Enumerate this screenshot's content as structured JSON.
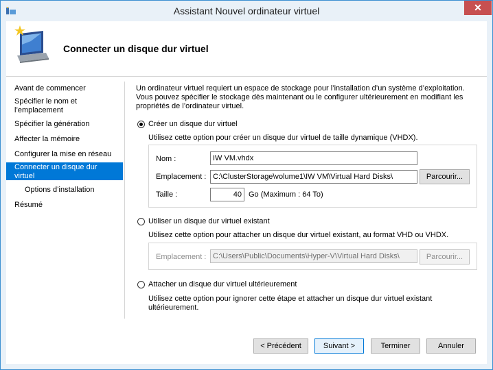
{
  "window": {
    "title": "Assistant Nouvel ordinateur virtuel",
    "close_glyph": "✕"
  },
  "header": {
    "title": "Connecter un disque dur virtuel"
  },
  "nav": {
    "items": [
      {
        "label": "Avant de commencer"
      },
      {
        "label": "Spécifier le nom et l’emplacement"
      },
      {
        "label": "Spécifier la génération"
      },
      {
        "label": "Affecter la mémoire"
      },
      {
        "label": "Configurer la mise en réseau"
      },
      {
        "label": "Connecter un disque dur virtuel"
      },
      {
        "label": "Options d’installation"
      },
      {
        "label": "Résumé"
      }
    ]
  },
  "content": {
    "intro": "Un ordinateur virtuel requiert un espace de stockage pour l’installation d’un système d’exploitation. Vous pouvez spécifier le stockage dès maintenant ou le configurer ultérieurement en modifiant les propriétés de l’ordinateur virtuel.",
    "create": {
      "label": "Créer un disque dur virtuel",
      "desc": "Utilisez cette option pour créer un disque dur virtuel de taille dynamique (VHDX).",
      "name_label": "Nom :",
      "name_value": "IW VM.vhdx",
      "location_label": "Emplacement :",
      "location_value": "C:\\ClusterStorage\\volume1\\IW VM\\Virtual Hard Disks\\",
      "browse_label": "Parcourir...",
      "size_label": "Taille :",
      "size_value": "40",
      "size_unit": "Go (Maximum : 64 To)"
    },
    "existing": {
      "label": "Utiliser un disque dur virtuel existant",
      "desc": "Utilisez cette option pour attacher un disque dur virtuel existant, au format VHD ou VHDX.",
      "location_label": "Emplacement :",
      "location_value": "C:\\Users\\Public\\Documents\\Hyper-V\\Virtual Hard Disks\\",
      "browse_label": "Parcourir..."
    },
    "later": {
      "label": "Attacher un disque dur virtuel ultérieurement",
      "desc": "Utilisez cette option pour ignorer cette étape et attacher un disque dur virtuel existant ultérieurement."
    }
  },
  "footer": {
    "previous": "< Précédent",
    "next": "Suivant >",
    "finish": "Terminer",
    "cancel": "Annuler"
  }
}
